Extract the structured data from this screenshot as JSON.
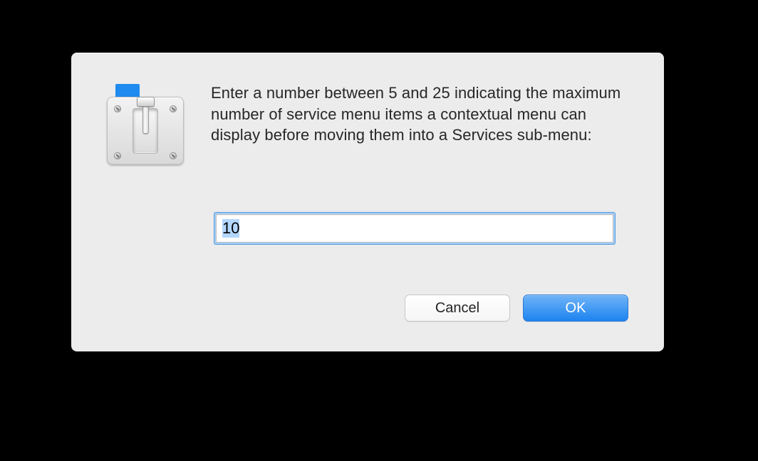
{
  "dialog": {
    "icon_name": "switch-plate-icon",
    "prompt": "Enter a number between 5 and 25 indicating the maximum number of service menu items a contextual menu can display before moving them into a Services sub-menu:",
    "field": {
      "value": "10",
      "min": 5,
      "max": 25
    },
    "buttons": {
      "cancel": "Cancel",
      "ok": "OK"
    }
  },
  "colors": {
    "accent": "#1d83f0",
    "focus_ring": "#a6cdf4",
    "dialog_bg": "#ececec"
  }
}
